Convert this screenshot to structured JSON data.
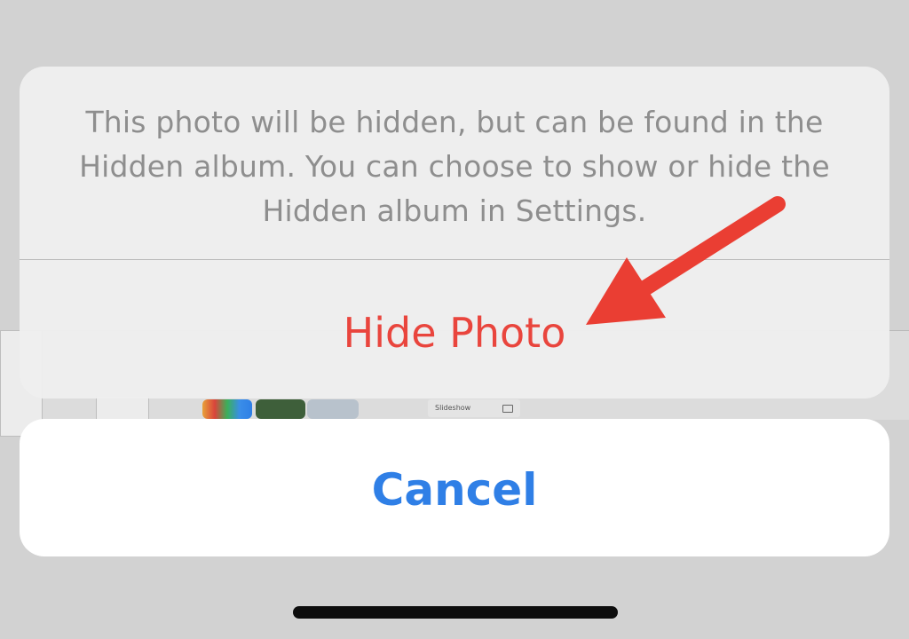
{
  "alert": {
    "message": "This photo will be hidden, but can be found in the Hidden album. You can choose to show or hide the Hidden album in Settings.",
    "destructive_action_label": "Hide Photo",
    "cancel_label": "Cancel"
  },
  "background": {
    "slideshow_label": "Slideshow"
  },
  "annotation": {
    "arrow_color": "#ea3e33",
    "arrow_icon": "red-arrow-icon"
  },
  "colors": {
    "destructive": "#e9453d",
    "cancel": "#2f7fe6",
    "message": "#8e8e8e"
  }
}
